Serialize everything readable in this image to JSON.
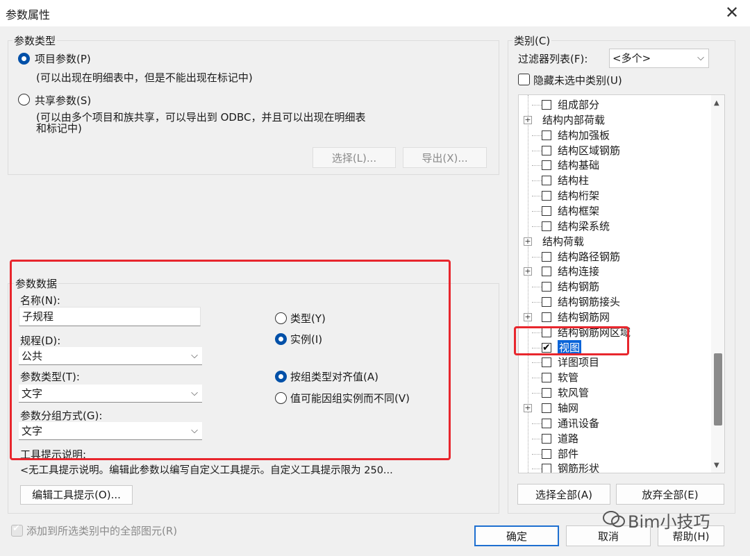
{
  "window": {
    "title": "参数属性",
    "close_icon": "close-icon"
  },
  "param_type": {
    "legend": "参数类型",
    "project_label": "项目参数(P)",
    "project_desc": "(可以出现在明细表中，但是不能出现在标记中)",
    "shared_label": "共享参数(S)",
    "shared_desc_1": "(可以由多个项目和族共享，可以导出到 ODBC，并且可以出现在明细表",
    "shared_desc_2": "和标记中)",
    "select_btn": "选择(L)...",
    "export_btn": "导出(X)..."
  },
  "param_data": {
    "legend": "参数数据",
    "name_label": "名称(N):",
    "name_value": "子规程",
    "discipline_label": "规程(D):",
    "discipline_value": "公共",
    "type_label": "参数类型(T):",
    "type_value": "文字",
    "group_label": "参数分组方式(G):",
    "group_value": "文字",
    "type_radio": "类型(Y)",
    "instance_radio": "实例(I)",
    "align_radio": "按组类型对齐值(A)",
    "vary_radio": "值可能因组实例而不同(V)",
    "tooltip_label": "工具提示说明:",
    "tooltip_text": "<无工具提示说明。编辑此参数以编写自定义工具提示。自定义工具提示限为 250...",
    "edit_tooltip_btn": "编辑工具提示(O)..."
  },
  "categories": {
    "legend": "类别(C)",
    "filter_label": "过滤器列表(F):",
    "filter_value": "<多个>",
    "hide_unchecked": "隐藏未选中类别(U)",
    "items": [
      {
        "label": "组成部分",
        "expandable": false,
        "checkbox": true,
        "checked": false
      },
      {
        "label": "结构内部荷载",
        "expandable": true,
        "checkbox": false,
        "checked": false
      },
      {
        "label": "结构加强板",
        "expandable": false,
        "checkbox": true,
        "checked": false
      },
      {
        "label": "结构区域钢筋",
        "expandable": false,
        "checkbox": true,
        "checked": false
      },
      {
        "label": "结构基础",
        "expandable": false,
        "checkbox": true,
        "checked": false
      },
      {
        "label": "结构柱",
        "expandable": false,
        "checkbox": true,
        "checked": false
      },
      {
        "label": "结构桁架",
        "expandable": false,
        "checkbox": true,
        "checked": false
      },
      {
        "label": "结构框架",
        "expandable": false,
        "checkbox": true,
        "checked": false
      },
      {
        "label": "结构梁系统",
        "expandable": false,
        "checkbox": true,
        "checked": false
      },
      {
        "label": "结构荷载",
        "expandable": true,
        "checkbox": false,
        "checked": false
      },
      {
        "label": "结构路径钢筋",
        "expandable": false,
        "checkbox": true,
        "checked": false
      },
      {
        "label": "结构连接",
        "expandable": true,
        "checkbox": true,
        "checked": false
      },
      {
        "label": "结构钢筋",
        "expandable": false,
        "checkbox": true,
        "checked": false
      },
      {
        "label": "结构钢筋接头",
        "expandable": false,
        "checkbox": true,
        "checked": false
      },
      {
        "label": "结构钢筋网",
        "expandable": true,
        "checkbox": true,
        "checked": false
      },
      {
        "label": "结构钢筋网区域",
        "expandable": false,
        "checkbox": true,
        "checked": false
      },
      {
        "label": "视图",
        "expandable": false,
        "checkbox": true,
        "checked": true,
        "selected": true
      },
      {
        "label": "详图项目",
        "expandable": false,
        "checkbox": true,
        "checked": false
      },
      {
        "label": "软管",
        "expandable": false,
        "checkbox": true,
        "checked": false
      },
      {
        "label": "软风管",
        "expandable": false,
        "checkbox": true,
        "checked": false
      },
      {
        "label": "轴网",
        "expandable": true,
        "checkbox": true,
        "checked": false
      },
      {
        "label": "通讯设备",
        "expandable": false,
        "checkbox": true,
        "checked": false
      },
      {
        "label": "道路",
        "expandable": false,
        "checkbox": true,
        "checked": false
      },
      {
        "label": "部件",
        "expandable": false,
        "checkbox": true,
        "checked": false
      },
      {
        "label": "钢筋形状",
        "expandable": false,
        "checkbox": true,
        "checked": false
      }
    ],
    "select_all_btn": "选择全部(A)",
    "deselect_all_btn": "放弃全部(E)"
  },
  "bottom": {
    "add_to_all": "添加到所选类别中的全部图元(R)",
    "ok_btn": "确定",
    "cancel_btn": "取消",
    "help_btn": "帮助(H)"
  },
  "watermark": "Bim小技巧",
  "colors": {
    "accent": "#0050a8",
    "highlight": "#e8262d",
    "selection": "#0a64d8"
  }
}
